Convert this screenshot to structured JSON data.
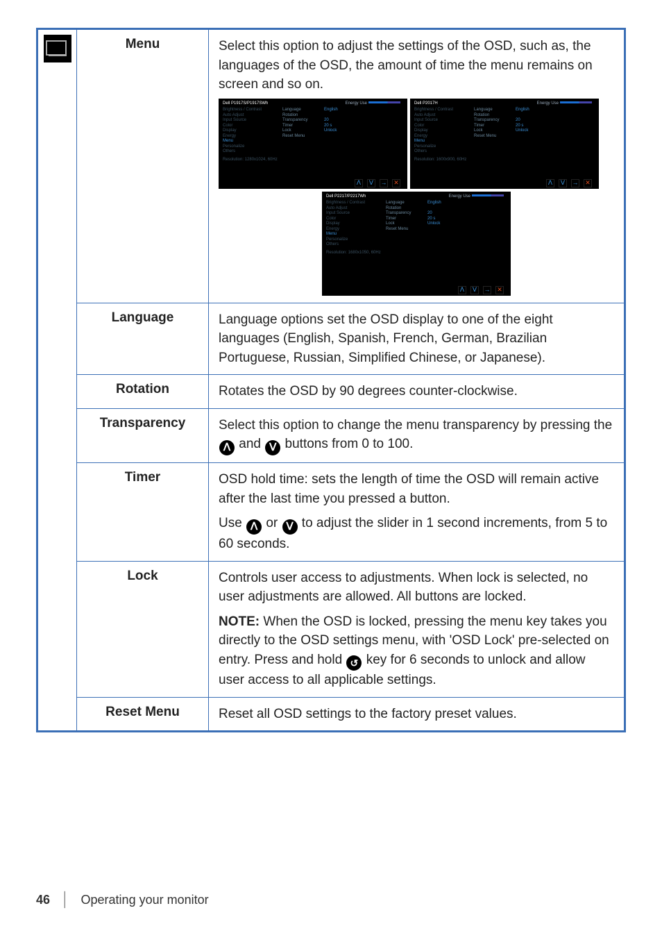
{
  "footer": {
    "page_num": "46",
    "section": "Operating your monitor"
  },
  "icons": {
    "up": "ᐱ",
    "down": "ᐯ",
    "right": "→",
    "close": "✕",
    "return": "↺"
  },
  "rows": {
    "menu": {
      "label": "Menu",
      "desc": "Select this option to adjust the settings of the OSD, such as, the languages of the OSD, the amount of time the menu remains on screen and so on."
    },
    "language": {
      "label": "Language",
      "desc": "Language options set the OSD display to one of the eight languages (English, Spanish, French, German, Brazilian Portuguese, Russian, Simplified Chinese, or Japanese)."
    },
    "rotation": {
      "label": "Rotation",
      "desc": "Rotates the OSD by 90 degrees counter-clockwise."
    },
    "transparency": {
      "label": "Transparency",
      "desc_pre": "Select this option to change the menu transparency by pressing the ",
      "desc_mid": " and ",
      "desc_post": " buttons from 0 to 100."
    },
    "timer": {
      "label": "Timer",
      "p1": "OSD hold time: sets the length of time the OSD will remain active after the last time you pressed a button.",
      "p2_pre": "Use ",
      "p2_mid": " or ",
      "p2_post": " to adjust the slider in 1 second increments, from 5 to 60 seconds."
    },
    "lock": {
      "label": "Lock",
      "p1": "Controls user access to adjustments. When lock is selected, no user adjustments are allowed. All buttons are locked.",
      "note_label": "NOTE:",
      "p2_pre": " When the OSD is locked, pressing the menu key takes you directly to the OSD settings menu, with 'OSD Lock' pre-selected on entry. Press and hold ",
      "p2_post": " key for 6 seconds to unlock and allow user access to all applicable settings."
    },
    "reset": {
      "label": "Reset Menu",
      "desc": "Reset all OSD settings to the factory preset values."
    }
  },
  "osd": {
    "model1_title": "Dell P1917S/P1917SWh",
    "model2_title": "Dell P2017H",
    "model3_title": "Dell P2217/P2217Wh",
    "energy_label": "Energy Use",
    "left_items": [
      "Brightness / Contrast",
      "Auto Adjust",
      "Input Source",
      "Color",
      "Display",
      "Energy",
      "Menu",
      "Personalize",
      "Others"
    ],
    "right_labels": [
      "Language",
      "Rotation",
      "Transparency",
      "Timer",
      "Lock",
      "Reset Menu"
    ],
    "right_values": [
      "English",
      "",
      "20",
      "20 s",
      "Unlock",
      ""
    ],
    "res1": "Resolution: 1280x1024, 60Hz",
    "res2": "Resolution: 1600x900, 60Hz",
    "res3": "Resolution: 1680x1050, 60Hz"
  }
}
